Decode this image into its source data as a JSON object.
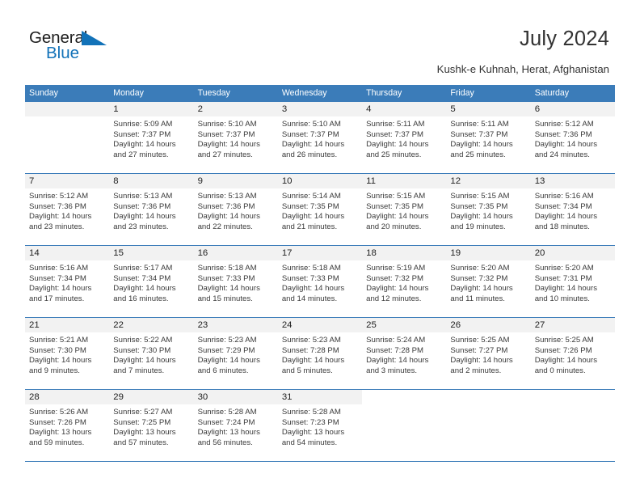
{
  "brand": {
    "word_one": "General",
    "word_two": "Blue",
    "triangle_color": "#1272b8",
    "text_color": "#1c1c1c"
  },
  "header": {
    "title": "July 2024",
    "location": "Kushk-e Kuhnah, Herat, Afghanistan"
  },
  "theme": {
    "header_blue": "#3b7cb9",
    "daynum_bg": "#f2f2f2",
    "text": "#3a3a3a"
  },
  "weekdays": [
    "Sunday",
    "Monday",
    "Tuesday",
    "Wednesday",
    "Thursday",
    "Friday",
    "Saturday"
  ],
  "weeks": [
    [
      {
        "day": "",
        "sunrise": "",
        "sunset": "",
        "daylight": "",
        "empty": true
      },
      {
        "day": "1",
        "sunrise": "Sunrise: 5:09 AM",
        "sunset": "Sunset: 7:37 PM",
        "daylight": "Daylight: 14 hours and 27 minutes."
      },
      {
        "day": "2",
        "sunrise": "Sunrise: 5:10 AM",
        "sunset": "Sunset: 7:37 PM",
        "daylight": "Daylight: 14 hours and 27 minutes."
      },
      {
        "day": "3",
        "sunrise": "Sunrise: 5:10 AM",
        "sunset": "Sunset: 7:37 PM",
        "daylight": "Daylight: 14 hours and 26 minutes."
      },
      {
        "day": "4",
        "sunrise": "Sunrise: 5:11 AM",
        "sunset": "Sunset: 7:37 PM",
        "daylight": "Daylight: 14 hours and 25 minutes."
      },
      {
        "day": "5",
        "sunrise": "Sunrise: 5:11 AM",
        "sunset": "Sunset: 7:37 PM",
        "daylight": "Daylight: 14 hours and 25 minutes."
      },
      {
        "day": "6",
        "sunrise": "Sunrise: 5:12 AM",
        "sunset": "Sunset: 7:36 PM",
        "daylight": "Daylight: 14 hours and 24 minutes."
      }
    ],
    [
      {
        "day": "7",
        "sunrise": "Sunrise: 5:12 AM",
        "sunset": "Sunset: 7:36 PM",
        "daylight": "Daylight: 14 hours and 23 minutes."
      },
      {
        "day": "8",
        "sunrise": "Sunrise: 5:13 AM",
        "sunset": "Sunset: 7:36 PM",
        "daylight": "Daylight: 14 hours and 23 minutes."
      },
      {
        "day": "9",
        "sunrise": "Sunrise: 5:13 AM",
        "sunset": "Sunset: 7:36 PM",
        "daylight": "Daylight: 14 hours and 22 minutes."
      },
      {
        "day": "10",
        "sunrise": "Sunrise: 5:14 AM",
        "sunset": "Sunset: 7:35 PM",
        "daylight": "Daylight: 14 hours and 21 minutes."
      },
      {
        "day": "11",
        "sunrise": "Sunrise: 5:15 AM",
        "sunset": "Sunset: 7:35 PM",
        "daylight": "Daylight: 14 hours and 20 minutes."
      },
      {
        "day": "12",
        "sunrise": "Sunrise: 5:15 AM",
        "sunset": "Sunset: 7:35 PM",
        "daylight": "Daylight: 14 hours and 19 minutes."
      },
      {
        "day": "13",
        "sunrise": "Sunrise: 5:16 AM",
        "sunset": "Sunset: 7:34 PM",
        "daylight": "Daylight: 14 hours and 18 minutes."
      }
    ],
    [
      {
        "day": "14",
        "sunrise": "Sunrise: 5:16 AM",
        "sunset": "Sunset: 7:34 PM",
        "daylight": "Daylight: 14 hours and 17 minutes."
      },
      {
        "day": "15",
        "sunrise": "Sunrise: 5:17 AM",
        "sunset": "Sunset: 7:34 PM",
        "daylight": "Daylight: 14 hours and 16 minutes."
      },
      {
        "day": "16",
        "sunrise": "Sunrise: 5:18 AM",
        "sunset": "Sunset: 7:33 PM",
        "daylight": "Daylight: 14 hours and 15 minutes."
      },
      {
        "day": "17",
        "sunrise": "Sunrise: 5:18 AM",
        "sunset": "Sunset: 7:33 PM",
        "daylight": "Daylight: 14 hours and 14 minutes."
      },
      {
        "day": "18",
        "sunrise": "Sunrise: 5:19 AM",
        "sunset": "Sunset: 7:32 PM",
        "daylight": "Daylight: 14 hours and 12 minutes."
      },
      {
        "day": "19",
        "sunrise": "Sunrise: 5:20 AM",
        "sunset": "Sunset: 7:32 PM",
        "daylight": "Daylight: 14 hours and 11 minutes."
      },
      {
        "day": "20",
        "sunrise": "Sunrise: 5:20 AM",
        "sunset": "Sunset: 7:31 PM",
        "daylight": "Daylight: 14 hours and 10 minutes."
      }
    ],
    [
      {
        "day": "21",
        "sunrise": "Sunrise: 5:21 AM",
        "sunset": "Sunset: 7:30 PM",
        "daylight": "Daylight: 14 hours and 9 minutes."
      },
      {
        "day": "22",
        "sunrise": "Sunrise: 5:22 AM",
        "sunset": "Sunset: 7:30 PM",
        "daylight": "Daylight: 14 hours and 7 minutes."
      },
      {
        "day": "23",
        "sunrise": "Sunrise: 5:23 AM",
        "sunset": "Sunset: 7:29 PM",
        "daylight": "Daylight: 14 hours and 6 minutes."
      },
      {
        "day": "24",
        "sunrise": "Sunrise: 5:23 AM",
        "sunset": "Sunset: 7:28 PM",
        "daylight": "Daylight: 14 hours and 5 minutes."
      },
      {
        "day": "25",
        "sunrise": "Sunrise: 5:24 AM",
        "sunset": "Sunset: 7:28 PM",
        "daylight": "Daylight: 14 hours and 3 minutes."
      },
      {
        "day": "26",
        "sunrise": "Sunrise: 5:25 AM",
        "sunset": "Sunset: 7:27 PM",
        "daylight": "Daylight: 14 hours and 2 minutes."
      },
      {
        "day": "27",
        "sunrise": "Sunrise: 5:25 AM",
        "sunset": "Sunset: 7:26 PM",
        "daylight": "Daylight: 14 hours and 0 minutes."
      }
    ],
    [
      {
        "day": "28",
        "sunrise": "Sunrise: 5:26 AM",
        "sunset": "Sunset: 7:26 PM",
        "daylight": "Daylight: 13 hours and 59 minutes."
      },
      {
        "day": "29",
        "sunrise": "Sunrise: 5:27 AM",
        "sunset": "Sunset: 7:25 PM",
        "daylight": "Daylight: 13 hours and 57 minutes."
      },
      {
        "day": "30",
        "sunrise": "Sunrise: 5:28 AM",
        "sunset": "Sunset: 7:24 PM",
        "daylight": "Daylight: 13 hours and 56 minutes."
      },
      {
        "day": "31",
        "sunrise": "Sunrise: 5:28 AM",
        "sunset": "Sunset: 7:23 PM",
        "daylight": "Daylight: 13 hours and 54 minutes."
      },
      {
        "day": "",
        "sunrise": "",
        "sunset": "",
        "daylight": "",
        "blank": true
      },
      {
        "day": "",
        "sunrise": "",
        "sunset": "",
        "daylight": "",
        "blank": true
      },
      {
        "day": "",
        "sunrise": "",
        "sunset": "",
        "daylight": "",
        "blank": true
      }
    ]
  ]
}
